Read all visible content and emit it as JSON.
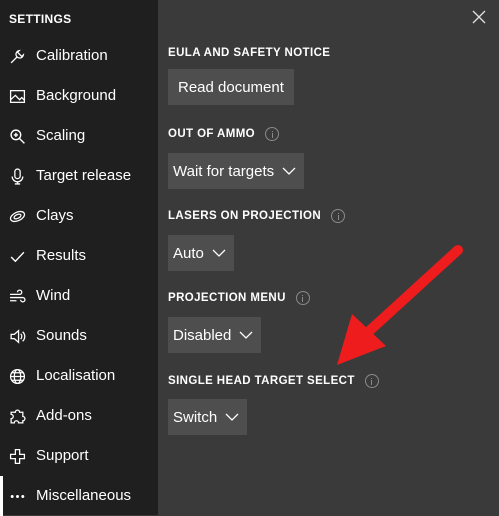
{
  "sidebar": {
    "title": "SETTINGS",
    "items": [
      {
        "label": "Calibration",
        "icon": "wrench-icon"
      },
      {
        "label": "Background",
        "icon": "image-icon"
      },
      {
        "label": "Scaling",
        "icon": "zoom-icon"
      },
      {
        "label": "Target release",
        "icon": "microphone-icon"
      },
      {
        "label": "Clays",
        "icon": "clay-disc-icon"
      },
      {
        "label": "Results",
        "icon": "checkmark-icon"
      },
      {
        "label": "Wind",
        "icon": "wind-icon"
      },
      {
        "label": "Sounds",
        "icon": "speaker-icon"
      },
      {
        "label": "Localisation",
        "icon": "globe-icon"
      },
      {
        "label": "Add-ons",
        "icon": "puzzle-icon"
      },
      {
        "label": "Support",
        "icon": "plus-icon"
      },
      {
        "label": "Miscellaneous",
        "icon": "more-icon",
        "active": true
      }
    ]
  },
  "main": {
    "eula": {
      "label": "EULA AND SAFETY NOTICE",
      "button": "Read document"
    },
    "out_of_ammo": {
      "label": "OUT OF AMMO",
      "value": "Wait for targets"
    },
    "lasers": {
      "label": "LASERS ON PROJECTION",
      "value": "Auto"
    },
    "projection_menu": {
      "label": "PROJECTION MENU",
      "value": "Disabled"
    },
    "single_head": {
      "label": "SINGLE HEAD TARGET SELECT",
      "value": "Switch"
    }
  },
  "colors": {
    "sidebar_bg": "#1f1f1f",
    "main_bg": "#3a3a3a",
    "control_bg": "#4e4e4e",
    "arrow": "#ee1c1c"
  }
}
